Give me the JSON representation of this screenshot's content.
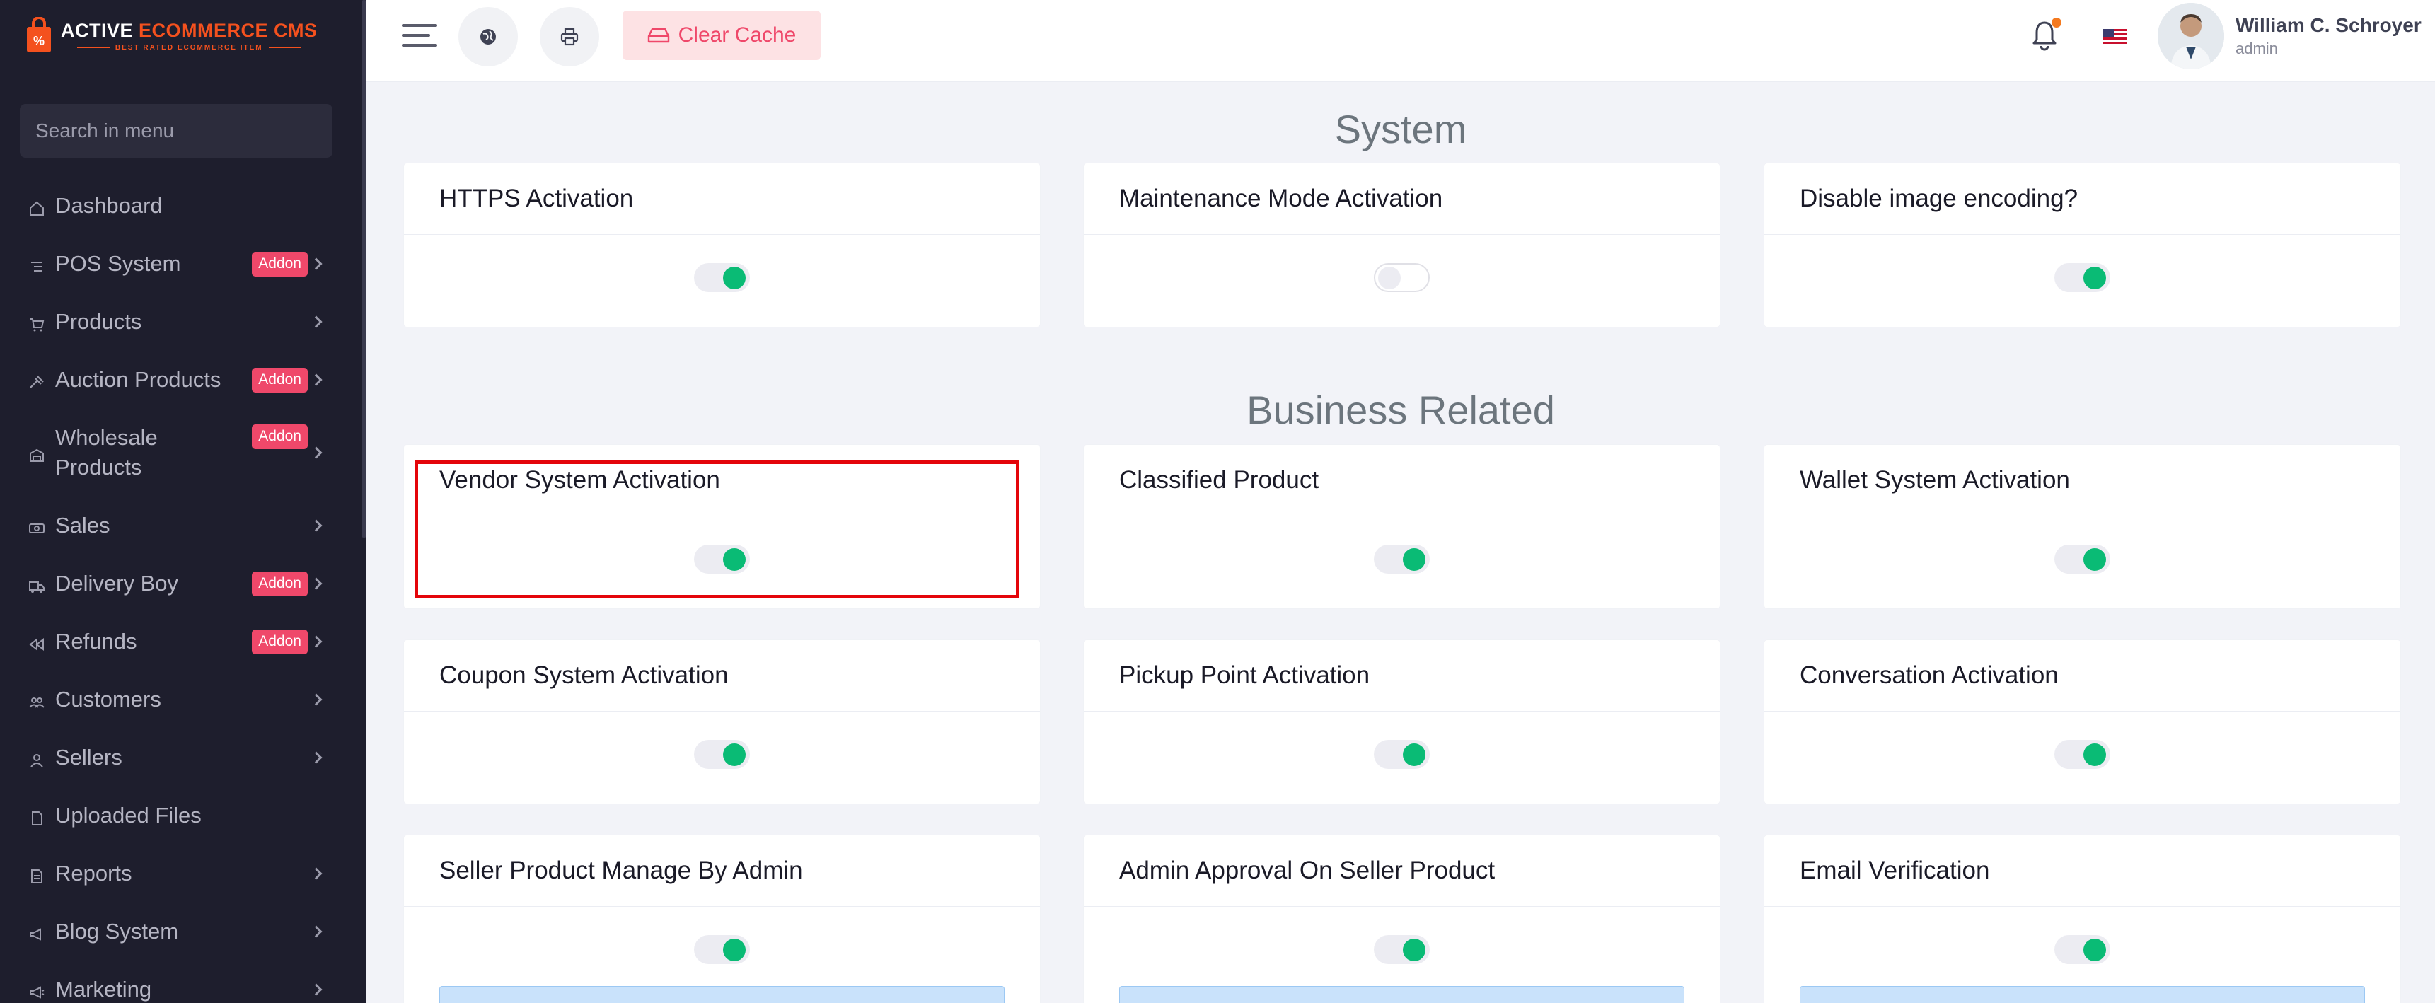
{
  "brand": {
    "title_part1": "ACTIVE ",
    "title_part2": "ECOMMERCE CMS",
    "subtitle": "BEST RATED ECOMMERCE ITEM"
  },
  "sidebar": {
    "search_placeholder": "Search in menu",
    "items": [
      {
        "label": "Dashboard",
        "icon": "home-icon",
        "badge": "",
        "chevron": false
      },
      {
        "label": "POS System",
        "icon": "list-icon",
        "badge": "Addon",
        "chevron": true
      },
      {
        "label": "Products",
        "icon": "cart-icon",
        "badge": "",
        "chevron": true
      },
      {
        "label": "Auction Products",
        "icon": "gavel-icon",
        "badge": "Addon",
        "chevron": true
      },
      {
        "label": "Wholesale Products",
        "icon": "warehouse-icon",
        "badge": "Addon",
        "chevron": true
      },
      {
        "label": "Sales",
        "icon": "money-icon",
        "badge": "",
        "chevron": true
      },
      {
        "label": "Delivery Boy",
        "icon": "truck-icon",
        "badge": "Addon",
        "chevron": true
      },
      {
        "label": "Refunds",
        "icon": "backward-icon",
        "badge": "Addon",
        "chevron": true
      },
      {
        "label": "Customers",
        "icon": "users-icon",
        "badge": "",
        "chevron": true
      },
      {
        "label": "Sellers",
        "icon": "user-icon",
        "badge": "",
        "chevron": true
      },
      {
        "label": "Uploaded Files",
        "icon": "folder-icon",
        "badge": "",
        "chevron": false
      },
      {
        "label": "Reports",
        "icon": "file-icon",
        "badge": "",
        "chevron": true
      },
      {
        "label": "Blog System",
        "icon": "bullhorn-icon",
        "badge": "",
        "chevron": true
      },
      {
        "label": "Marketing",
        "icon": "megaphone-icon",
        "badge": "",
        "chevron": true
      }
    ]
  },
  "topbar": {
    "clear_cache_label": "Clear Cache",
    "user_name": "William C. Schroyer",
    "user_role": "admin"
  },
  "sections": {
    "system": "System",
    "business": "Business Related"
  },
  "cards": {
    "https": {
      "title": "HTTPS Activation",
      "enabled": true
    },
    "maintenance": {
      "title": "Maintenance Mode Activation",
      "enabled": false
    },
    "image_encoding": {
      "title": "Disable image encoding?",
      "enabled": true
    },
    "vendor": {
      "title": "Vendor System Activation",
      "enabled": true
    },
    "classified": {
      "title": "Classified Product",
      "enabled": true
    },
    "wallet": {
      "title": "Wallet System Activation",
      "enabled": true
    },
    "coupon": {
      "title": "Coupon System Activation",
      "enabled": true
    },
    "pickup": {
      "title": "Pickup Point Activation",
      "enabled": true
    },
    "conversation": {
      "title": "Conversation Activation",
      "enabled": true
    },
    "seller_manage": {
      "title": "Seller Product Manage By Admin",
      "enabled": true
    },
    "admin_approval": {
      "title": "Admin Approval On Seller Product",
      "enabled": true
    },
    "email_verification": {
      "title": "Email Verification",
      "enabled": true
    }
  },
  "colors": {
    "accent": "#f4511e",
    "toggle_on": "#0abb75",
    "badge": "#ef486a",
    "sidebar_bg": "#1e1e2d",
    "highlight": "#e4050a"
  }
}
